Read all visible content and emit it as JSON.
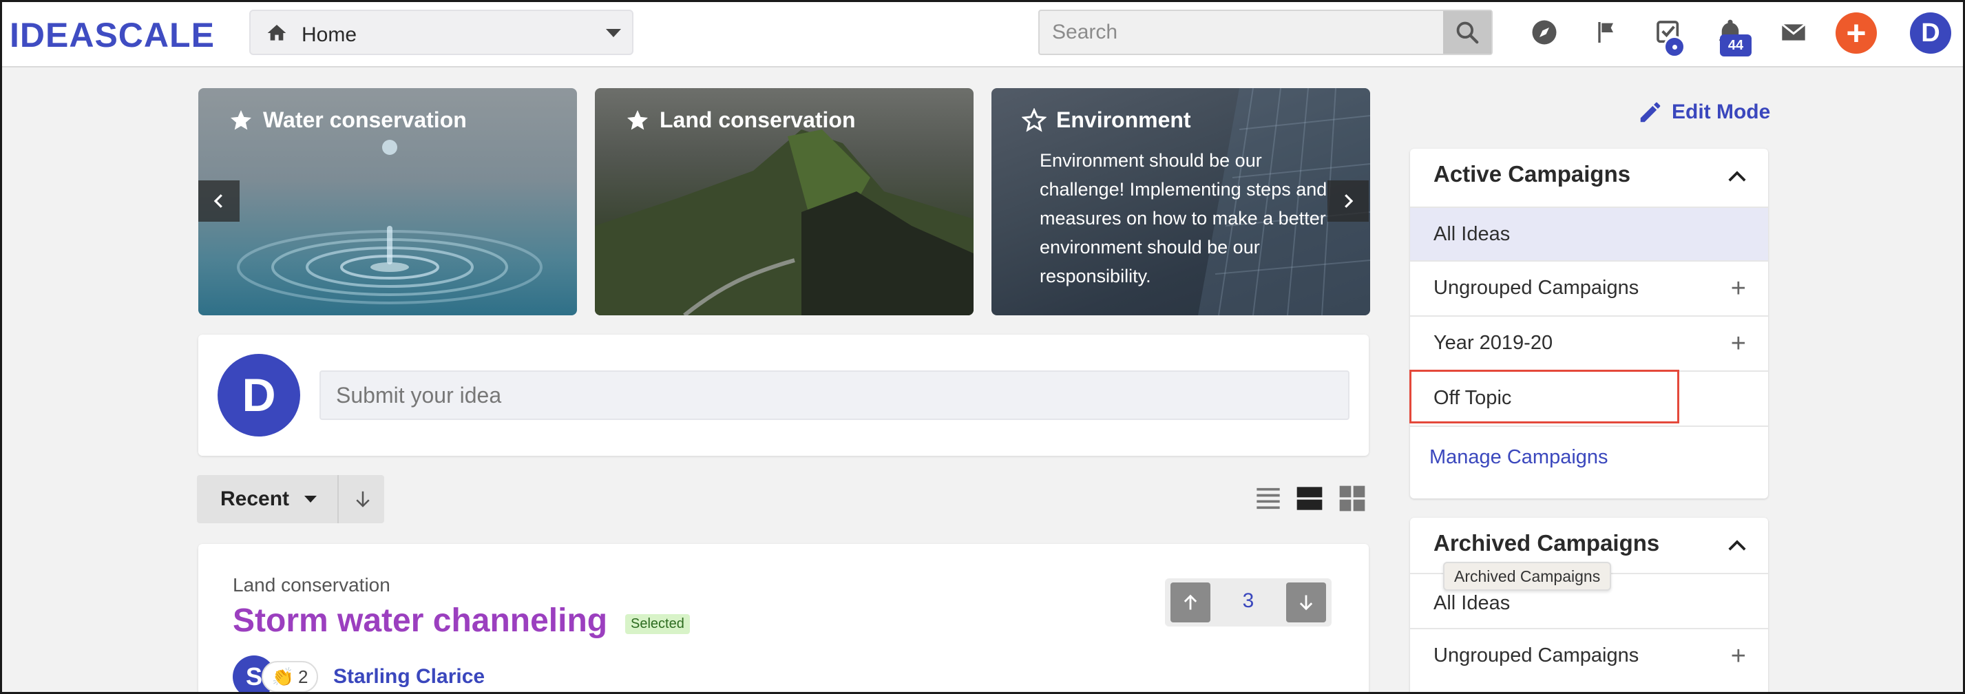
{
  "app": {
    "logo": "IDEASCALE"
  },
  "header": {
    "community_select": {
      "value": "Home"
    },
    "search": {
      "placeholder": "Search"
    },
    "notifications_count": "44",
    "avatar_initial": "D",
    "add_label": "+"
  },
  "featured": [
    {
      "title": "Water conservation",
      "starred": true,
      "description": ""
    },
    {
      "title": "Land conservation",
      "starred": true,
      "description": ""
    },
    {
      "title": "Environment",
      "starred": false,
      "description": "Environment should be our challenge! Implementing steps and measures on how to make a better environment should be our responsibility."
    }
  ],
  "submit": {
    "avatar_initial": "D",
    "placeholder": "Submit your idea"
  },
  "sort": {
    "label": "Recent"
  },
  "idea": {
    "campaign": "Land conservation",
    "title": "Storm water channeling",
    "badge": "Selected",
    "votes": "3",
    "author_initial": "S",
    "claps": "2",
    "author": "Starling Clarice"
  },
  "sidebar": {
    "edit_mode": "Edit Mode",
    "active": {
      "title": "Active Campaigns",
      "items": [
        {
          "label": "All Ideas"
        },
        {
          "label": "Ungrouped Campaigns"
        },
        {
          "label": "Year 2019-20"
        },
        {
          "label": "Off Topic"
        }
      ],
      "manage": "Manage Campaigns"
    },
    "archived": {
      "title": "Archived Campaigns",
      "tooltip": "Archived Campaigns",
      "items": [
        {
          "label": "All Ideas"
        },
        {
          "label": "Ungrouped Campaigns"
        }
      ]
    }
  },
  "colors": {
    "brand": "#3a47bd",
    "accent": "#ee5a2b",
    "idea_title": "#9b3fbf",
    "highlight": "#e4493b"
  }
}
